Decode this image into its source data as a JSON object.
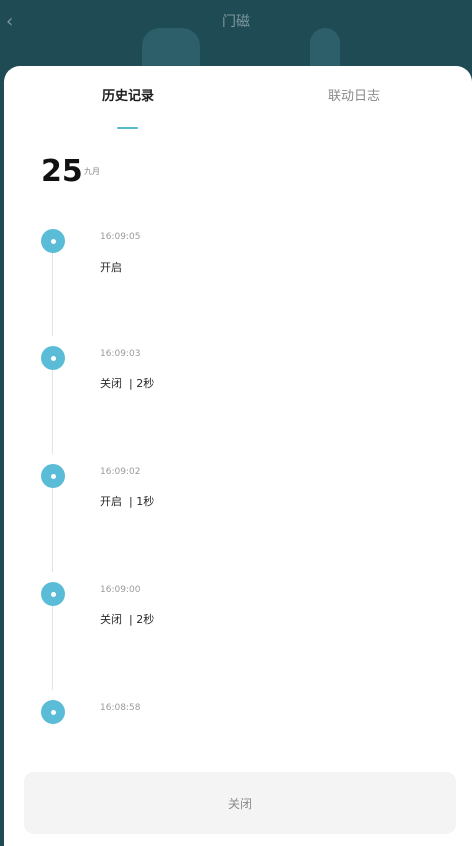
{
  "app_bar": {
    "title": "门磁",
    "back_icon": "chevron-left-icon"
  },
  "tabs": [
    {
      "label": "历史记录",
      "active": true
    },
    {
      "label": "联动日志",
      "active": false
    }
  ],
  "date": {
    "day": "25",
    "month": "九月"
  },
  "records": [
    {
      "time": "16:09:05",
      "state": "开启"
    },
    {
      "time": "16:09:03",
      "state": "关闭  | 2秒"
    },
    {
      "time": "16:09:02",
      "state": "开启  | 1秒"
    },
    {
      "time": "16:09:00",
      "state": "关闭  | 2秒"
    },
    {
      "time": "16:08:58",
      "state": ""
    }
  ],
  "close_label": "关闭",
  "colors": {
    "accent": "#5bbcd8",
    "header": "#1f4b54"
  }
}
